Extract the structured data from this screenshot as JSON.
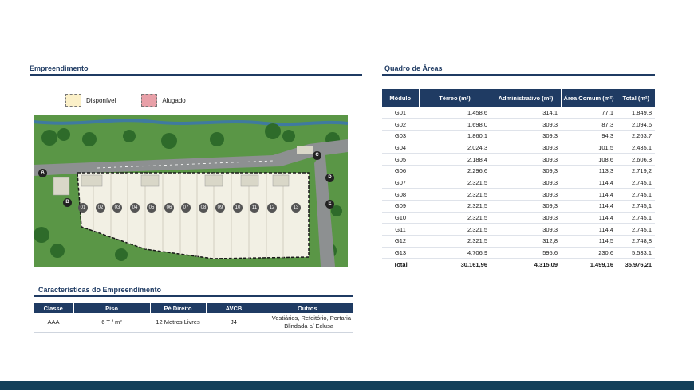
{
  "sections": {
    "empreendimento": "Empreendimento",
    "quadro": "Quadro de Áreas",
    "caracteristicas": "Características do Empreendimento"
  },
  "legend": [
    {
      "label": "Disponível",
      "color": "#fbf0c8"
    },
    {
      "label": "Alugado",
      "color": "#e8a0a8"
    }
  ],
  "map": {
    "markers": [
      "A",
      "B",
      "C",
      "D",
      "E"
    ],
    "modules": [
      "01",
      "02",
      "03",
      "04",
      "05",
      "06",
      "07",
      "08",
      "09",
      "10",
      "11",
      "12",
      "13"
    ]
  },
  "areas": {
    "headers": [
      "Módulo",
      "Térreo (m²)",
      "Administrativo (m²)",
      "Área Comum (m²)",
      "Total (m²)"
    ],
    "rows": [
      [
        "G01",
        "1.458,6",
        "314,1",
        "77,1",
        "1.849,8"
      ],
      [
        "G02",
        "1.698,0",
        "309,3",
        "87,3",
        "2.094,6"
      ],
      [
        "G03",
        "1.860,1",
        "309,3",
        "94,3",
        "2.263,7"
      ],
      [
        "G04",
        "2.024,3",
        "309,3",
        "101,5",
        "2.435,1"
      ],
      [
        "G05",
        "2.188,4",
        "309,3",
        "108,6",
        "2.606,3"
      ],
      [
        "G06",
        "2.296,6",
        "309,3",
        "113,3",
        "2.719,2"
      ],
      [
        "G07",
        "2.321,5",
        "309,3",
        "114,4",
        "2.745,1"
      ],
      [
        "G08",
        "2.321,5",
        "309,3",
        "114,4",
        "2.745,1"
      ],
      [
        "G09",
        "2.321,5",
        "309,3",
        "114,4",
        "2.745,1"
      ],
      [
        "G10",
        "2.321,5",
        "309,3",
        "114,4",
        "2.745,1"
      ],
      [
        "G11",
        "2.321,5",
        "309,3",
        "114,4",
        "2.745,1"
      ],
      [
        "G12",
        "2.321,5",
        "312,8",
        "114,5",
        "2.748,8"
      ],
      [
        "G13",
        "4.706,9",
        "595,6",
        "230,6",
        "5.533,1"
      ]
    ],
    "total": [
      "Total",
      "30.161,96",
      "4.315,09",
      "1.499,16",
      "35.976,21"
    ]
  },
  "characteristics": {
    "headers": [
      "Classe",
      "Piso",
      "Pé Direito",
      "AVCB",
      "Outros"
    ],
    "row": {
      "classe": "AAA",
      "piso": "6 T / m²",
      "pe_direito": "12 Metros Livres",
      "avcb": "J4",
      "outros_line1": "Vestiários, Refeitório, Portaria",
      "outros_line2": "Blindada c/ Eclusa"
    }
  },
  "colors": {
    "primary": "#1f3b63",
    "footer": "#14405a",
    "grass": "#5e9a48"
  }
}
